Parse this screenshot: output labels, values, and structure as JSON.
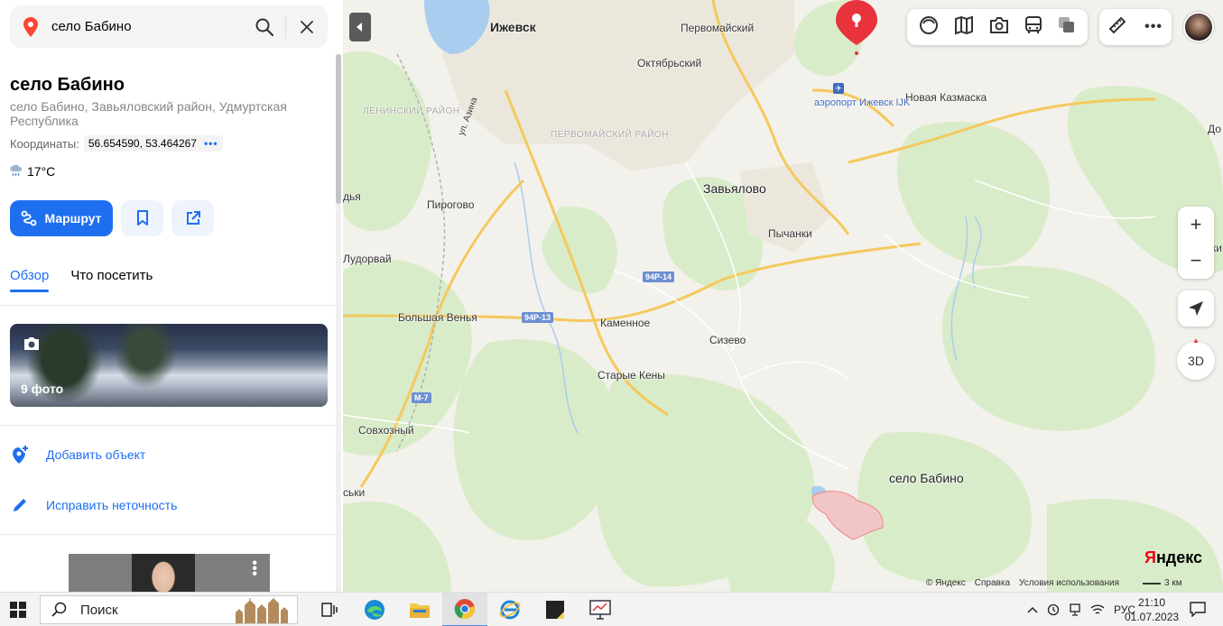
{
  "search": {
    "query": "село Бабино"
  },
  "place": {
    "title": "село Бабино",
    "address": "село Бабино, Завьяловский район, Удмуртская Республика",
    "coords_label": "Координаты:",
    "coords_value": "56.654590, 53.464267",
    "coords_more": "•••",
    "weather": "17°C"
  },
  "buttons": {
    "route": "Маршрут"
  },
  "tabs": [
    {
      "label": "Обзор",
      "active": true
    },
    {
      "label": "Что посетить",
      "active": false
    }
  ],
  "photos": {
    "count_label": "9 фото"
  },
  "actions": {
    "add_object": "Добавить объект",
    "fix_error": "Исправить неточность"
  },
  "map": {
    "cities": {
      "izhevsk": "Ижевск",
      "zavyalovo": "Завьялово",
      "pervomaisky": "Первомайский",
      "oktyabrsky": "Октябрьский",
      "novaya_kazmaska": "Новая Казмаска",
      "pychanki": "Пычанки",
      "pirogovo": "Пирогово",
      "ludorvai": "Лудорвай",
      "bolshaya_venya": "Большая Венья",
      "kamennoe": "Каменное",
      "sizevo": "Сизево",
      "starye_keny": "Старые Кены",
      "sovkhozny": "Совхозный",
      "dyamedge": "дья",
      "skiy_edge": "ськи",
      "do_edge": "До",
      "ki_edge": "ки"
    },
    "districts": {
      "leninsky": "ЛЕНИНСКИЙ РАЙОН",
      "pervomaisky": "ПЕРВОМАЙСКИЙ РАЙОН"
    },
    "street": "ул. Азина",
    "airport": "аэропорт Ижевск IJK",
    "roads": {
      "r1": "94Р-14",
      "r2": "94Р-13",
      "r3": "М-7"
    },
    "marker_label": "село Бабино",
    "btn_3d": "3D",
    "compass_n": "▲",
    "zoom_in": "+",
    "zoom_out": "−",
    "logo_first": "Я",
    "logo_rest": "ндекс",
    "copyright": [
      "© Яндекс",
      "Справка",
      "Условия использования"
    ],
    "scale": "3 км"
  },
  "taskbar": {
    "search_placeholder": "Поиск",
    "lang": "РУС",
    "time": "21:10",
    "date": "01.07.2023"
  },
  "colors": {
    "accent": "#1e6ff0",
    "marker": "#e8323c",
    "area_fill": "#f2c6c6"
  }
}
